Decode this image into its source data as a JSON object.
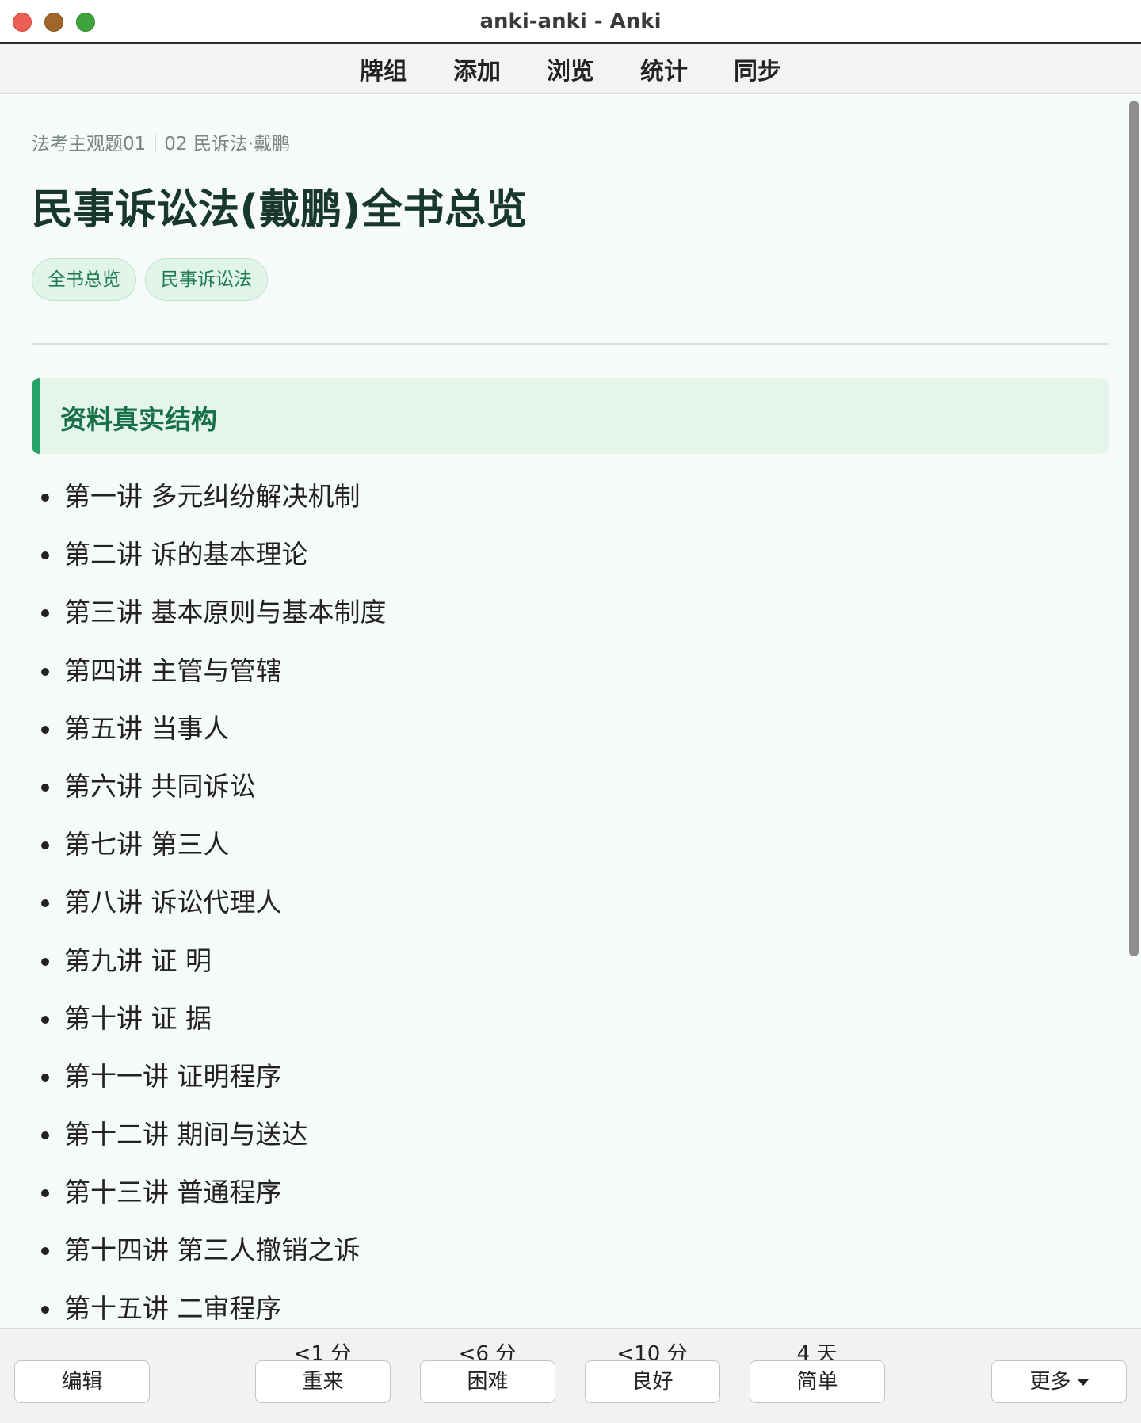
{
  "window": {
    "title": "anki-anki - Anki"
  },
  "toolbar": {
    "items": [
      {
        "label": "牌组"
      },
      {
        "label": "添加"
      },
      {
        "label": "浏览"
      },
      {
        "label": "统计"
      },
      {
        "label": "同步"
      }
    ]
  },
  "card": {
    "breadcrumb": "法考主观题01｜02 民诉法·戴鹏",
    "title": "民事诉讼法(戴鹏)全书总览",
    "tags": [
      "全书总览",
      "民事诉讼法"
    ],
    "section_title": "资料真实结构",
    "lectures": [
      "第一讲 多元纠纷解决机制",
      "第二讲 诉的基本理论",
      "第三讲 基本原则与基本制度",
      "第四讲 主管与管辖",
      "第五讲 当事人",
      "第六讲 共同诉讼",
      "第七讲 第三人",
      "第八讲 诉讼代理人",
      "第九讲 证 明",
      "第十讲 证 据",
      "第十一讲 证明程序",
      "第十二讲 期间与送达",
      "第十三讲 普通程序",
      "第十四讲 第三人撤销之诉",
      "第十五讲 二审程序"
    ]
  },
  "answer_bar": {
    "edit_label": "编辑",
    "again": {
      "label": "重来",
      "interval": "<1 分"
    },
    "hard": {
      "label": "困难",
      "interval": "<6 分"
    },
    "good": {
      "label": "良好",
      "interval": "<10 分"
    },
    "easy": {
      "label": "简单",
      "interval": "4 天"
    },
    "more_label": "更多",
    "more_icon": "caret-down-icon"
  },
  "colors": {
    "accent_green": "#25a46a",
    "title_green": "#17382a",
    "tag_text": "#1e7a4f",
    "content_bg": "#f6faf9"
  }
}
